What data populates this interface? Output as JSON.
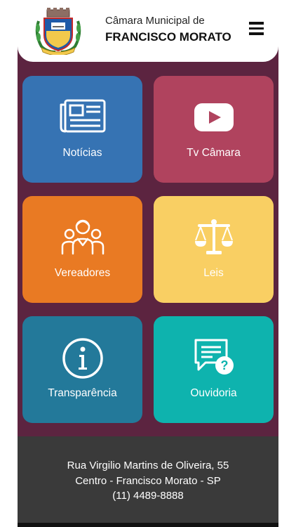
{
  "header": {
    "subtitle": "Câmara Municipal de",
    "title": "FRANCISCO MORATO",
    "logo_icon": "municipal-crest-icon",
    "menu_icon": "hamburger-menu-icon"
  },
  "tiles": [
    {
      "label": "Notícias",
      "icon": "newspaper-icon",
      "color": "#3673b3"
    },
    {
      "label": "Tv Câmara",
      "icon": "play-video-icon",
      "color": "#b0435e"
    },
    {
      "label": "Vereadores",
      "icon": "people-group-icon",
      "color": "#e97a23"
    },
    {
      "label": "Leis",
      "icon": "scales-justice-icon",
      "color": "#f9cf63"
    },
    {
      "label": "Transparência",
      "icon": "info-icon",
      "color": "#23799a"
    },
    {
      "label": "Ouvidoria",
      "icon": "chat-question-icon",
      "color": "#0eb3ae"
    }
  ],
  "footer": {
    "address_line1": "Rua Virgilio Martins de Oliveira, 55",
    "address_line2": "Centro - Francisco Morato - SP",
    "phone": "(11) 4489-8888"
  },
  "colors": {
    "background": "#5c2440",
    "header_bg": "#ffffff",
    "footer_bg": "#3a3a3a"
  }
}
